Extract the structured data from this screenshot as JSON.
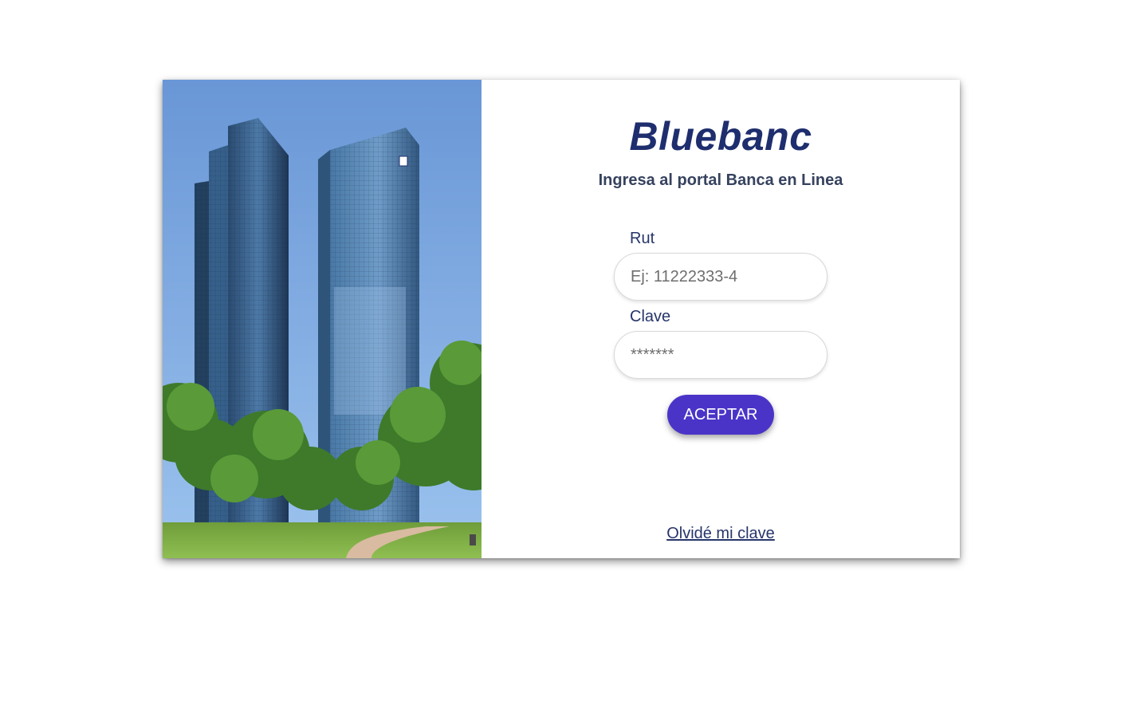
{
  "brand": {
    "name": "Bluebanc"
  },
  "login": {
    "subtitle": "Ingresa al portal Banca en Linea",
    "rut_label": "Rut",
    "rut_placeholder": "Ej: 11222333-4",
    "clave_label": "Clave",
    "clave_placeholder": "*******",
    "submit_label": "ACEPTAR",
    "forgot_label": "Olvidé mi clave"
  },
  "colors": {
    "brand_text": "#1e2e6e",
    "button_bg": "#4a34c8",
    "sky": "#7aa8e4",
    "grass": "#7fae45"
  },
  "image": {
    "subject": "twin-glass-towers-photo"
  }
}
